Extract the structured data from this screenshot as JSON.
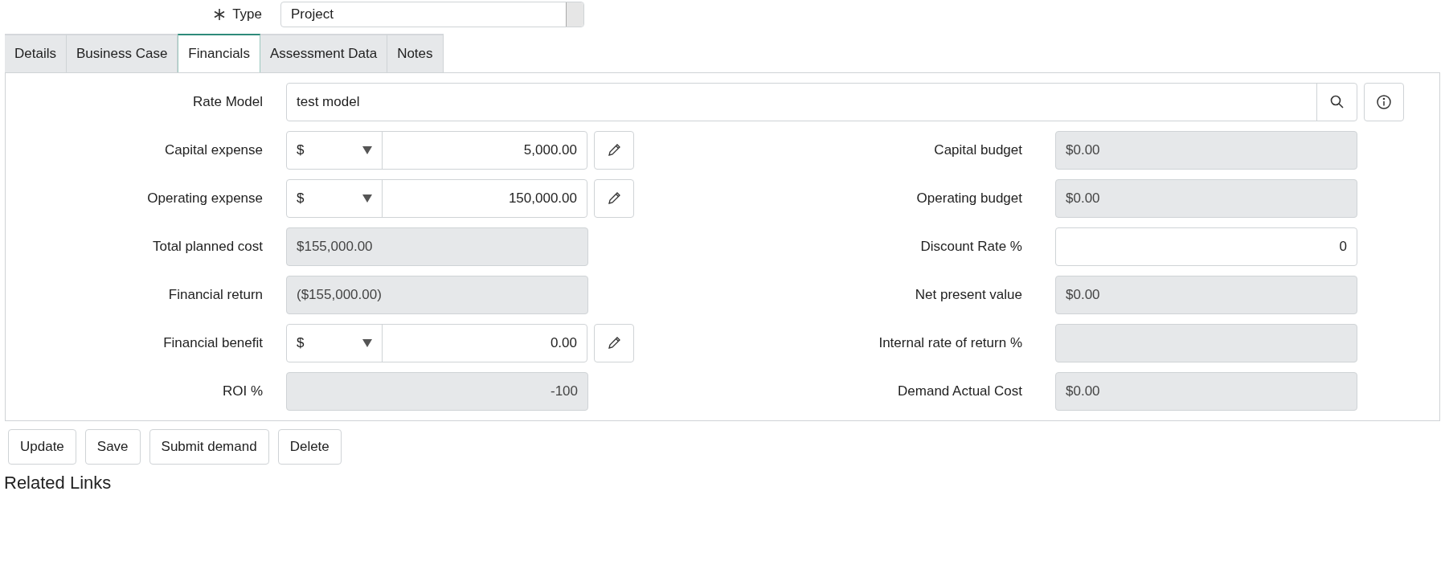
{
  "type_field": {
    "label": "Type",
    "required": true,
    "value": "Project"
  },
  "tabs": [
    {
      "label": "Details",
      "selected": false
    },
    {
      "label": "Business Case",
      "selected": false
    },
    {
      "label": "Financials",
      "selected": true
    },
    {
      "label": "Assessment Data",
      "selected": false
    },
    {
      "label": "Notes",
      "selected": false
    }
  ],
  "rate_model": {
    "label": "Rate Model",
    "value": "test model"
  },
  "left_fields": [
    {
      "kind": "currency",
      "label": "Capital expense",
      "currency": "$",
      "value": "5,000.00"
    },
    {
      "kind": "currency",
      "label": "Operating expense",
      "currency": "$",
      "value": "150,000.00"
    },
    {
      "kind": "readonly",
      "label": "Total planned cost",
      "value": "$155,000.00"
    },
    {
      "kind": "readonly",
      "label": "Financial return",
      "value": "($155,000.00)"
    },
    {
      "kind": "currency",
      "label": "Financial benefit",
      "currency": "$",
      "value": "0.00"
    },
    {
      "kind": "readonly_number",
      "label": "ROI %",
      "value": "-100"
    }
  ],
  "right_fields": [
    {
      "kind": "readonly",
      "label": "Capital budget",
      "value": "$0.00"
    },
    {
      "kind": "readonly",
      "label": "Operating budget",
      "value": "$0.00"
    },
    {
      "kind": "input",
      "label": "Discount Rate %",
      "value": "0"
    },
    {
      "kind": "readonly",
      "label": "Net present value",
      "value": "$0.00"
    },
    {
      "kind": "readonly",
      "label": "Internal rate of return %"
    },
    {
      "kind": "readonly",
      "label": "Demand Actual Cost",
      "value": "$0.00"
    }
  ],
  "buttons": [
    "Update",
    "Save",
    "Submit demand",
    "Delete"
  ],
  "related_links": {
    "title": "Related Links"
  }
}
